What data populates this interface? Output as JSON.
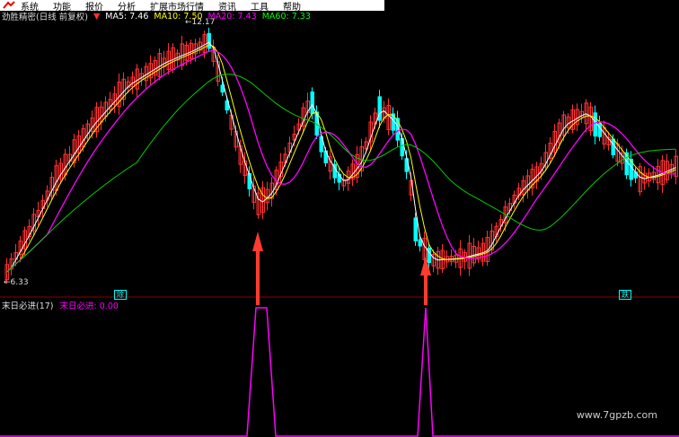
{
  "menu": [
    "系统",
    "功能",
    "报价",
    "分析",
    "扩展市场行情",
    "资讯",
    "工具",
    "帮助"
  ],
  "chart_title": "劲胜精密(日线 前复权)",
  "ma": {
    "ma5": "MA5: 7.46",
    "ma10": "MA10: 7.50",
    "ma20": "MA20: 7.43",
    "ma60": "MA60: 7.33"
  },
  "high_label": "12.17",
  "low_label": "6.33",
  "indicator": {
    "name": "末日必进(17)",
    "value": "末日必进: 0.00"
  },
  "tags": {
    "left": "除",
    "right": "跌"
  },
  "watermark": "www.7gpzb.com",
  "colors": {
    "up": "#ff3232",
    "down": "#00ffff",
    "ma5": "#ffffff",
    "ma10": "#ffff00",
    "ma20": "#ff00ff",
    "ma60": "#00cc00",
    "signal": "#ff00ff"
  }
}
